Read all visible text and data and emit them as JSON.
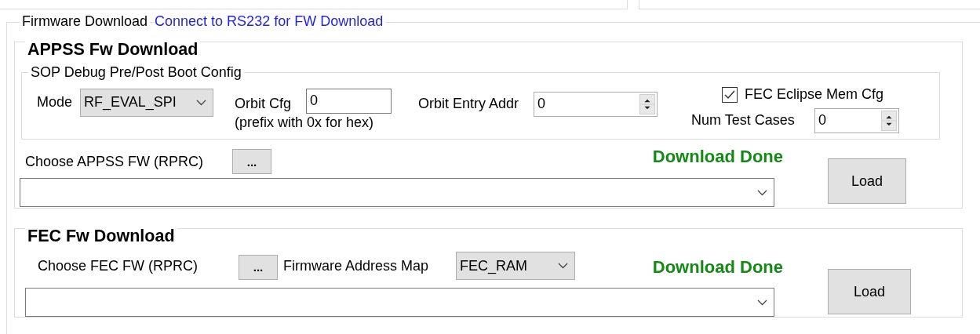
{
  "firmware": {
    "title": "Firmware Download",
    "link": "Connect to RS232 for FW Download"
  },
  "appss": {
    "title": "APPSS Fw Download",
    "sop": {
      "title": "SOP Debug Pre/Post Boot Config",
      "mode_label": "Mode",
      "mode_value": "RF_EVAL_SPI",
      "orbit_cfg_label": "Orbit Cfg",
      "orbit_cfg_value": "0",
      "orbit_cfg_hint": "(prefix with 0x for hex)",
      "orbit_entry_label": "Orbit Entry Addr",
      "orbit_entry_value": "0",
      "fec_eclipse": {
        "label": "FEC Eclipse Mem Cfg",
        "checked": true
      },
      "num_test_label": "Num Test Cases",
      "num_test_value": "0"
    },
    "choose_label": "Choose APPSS FW (RPRC)",
    "browse": "...",
    "status": "Download Done",
    "load": "Load"
  },
  "fec": {
    "title": "FEC Fw Download",
    "choose_label": "Choose FEC FW (RPRC)",
    "browse": "...",
    "map_label": "Firmware Address Map",
    "map_value": "FEC_RAM",
    "status": "Download Done",
    "load": "Load"
  }
}
